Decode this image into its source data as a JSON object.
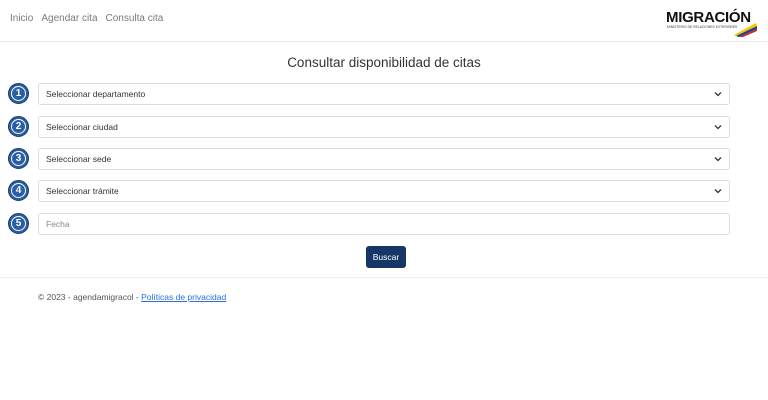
{
  "nav": {
    "items": [
      "Inicio",
      "Agendar cita",
      "Consulta cita"
    ]
  },
  "logo": {
    "word": "MIGRACIÓN",
    "subtitle": "MINISTERIO DE RELACIONES EXTERIORES"
  },
  "page": {
    "title": "Consultar disponibilidad de citas"
  },
  "form": {
    "fields": [
      {
        "number": "1",
        "label": "Seleccionar departamento",
        "type": "select"
      },
      {
        "number": "2",
        "label": "Seleccionar ciudad",
        "type": "select"
      },
      {
        "number": "3",
        "label": "Seleccionar sede",
        "type": "select"
      },
      {
        "number": "4",
        "label": "Seleccionar trámite",
        "type": "select"
      },
      {
        "number": "5",
        "label": "Fecha",
        "type": "input"
      }
    ],
    "submit_label": "Buscar"
  },
  "footer": {
    "text": "© 2023 - agendamigracol - ",
    "link": "Políticas de privacidad"
  },
  "colors": {
    "accent": "#173668",
    "badge": "#2a5fa3",
    "link": "#2a6fd6"
  }
}
